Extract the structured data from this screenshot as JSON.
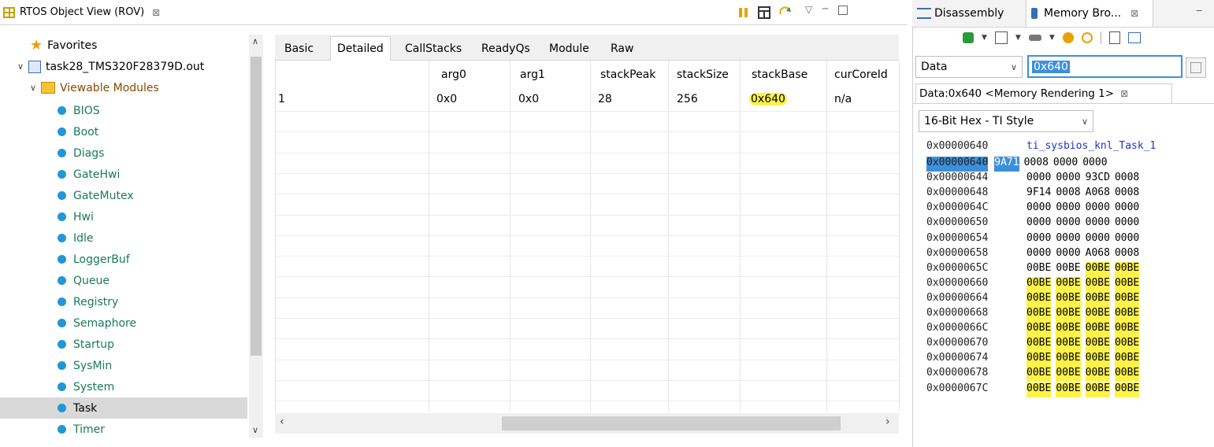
{
  "rov": {
    "title": "RTOS Object View (ROV)",
    "close_glyph": "⊠",
    "tree": {
      "favorites": "Favorites",
      "executable": "task28_TMS320F28379D.out",
      "viewable_modules": "Viewable Modules",
      "modules": [
        "BIOS",
        "Boot",
        "Diags",
        "GateHwi",
        "GateMutex",
        "Hwi",
        "Idle",
        "LoggerBuf",
        "Queue",
        "Registry",
        "Semaphore",
        "Startup",
        "SysMin",
        "System",
        "Task",
        "Timer"
      ],
      "selected": "Task"
    },
    "tabs": [
      "Basic",
      "Detailed",
      "CallStacks",
      "ReadyQs",
      "Module",
      "Raw"
    ],
    "active_tab": "Detailed",
    "table": {
      "columns": [
        "arg0",
        "arg1",
        "stackPeak",
        "stackSize",
        "stackBase",
        "curCoreId"
      ],
      "first_col_fragment": "1",
      "row": [
        "0x0",
        "0x0",
        "28",
        "256",
        "0x640",
        "n/a"
      ]
    }
  },
  "right": {
    "tabs": [
      "Disassembly",
      "Memory Bro..."
    ],
    "active_tab": "Memory Bro...",
    "close_glyph": "⊠",
    "page_select": "Data",
    "address_input": "0x640",
    "rendering_tab": "Data:0x640 <Memory Rendering 1>",
    "format_select": "16-Bit Hex - TI Style",
    "symbol_row": {
      "addr": "0x00000640",
      "symbol": "ti_sysbios_knl_Task_1"
    },
    "rows": [
      {
        "addr": "0x00000640",
        "vals": [
          "9A71",
          "0008",
          "0000",
          "0000"
        ]
      },
      {
        "addr": "0x00000644",
        "vals": [
          "0000",
          "0000",
          "93CD",
          "0008"
        ]
      },
      {
        "addr": "0x00000648",
        "vals": [
          "9F14",
          "0008",
          "A068",
          "0008"
        ]
      },
      {
        "addr": "0x0000064C",
        "vals": [
          "0000",
          "0000",
          "0000",
          "0000"
        ]
      },
      {
        "addr": "0x00000650",
        "vals": [
          "0000",
          "0000",
          "0000",
          "0000"
        ]
      },
      {
        "addr": "0x00000654",
        "vals": [
          "0000",
          "0000",
          "0000",
          "0000"
        ]
      },
      {
        "addr": "0x00000658",
        "vals": [
          "0000",
          "0000",
          "A068",
          "0008"
        ]
      },
      {
        "addr": "0x0000065C",
        "vals": [
          "00BE",
          "00BE",
          "00BE",
          "00BE"
        ]
      },
      {
        "addr": "0x00000660",
        "vals": [
          "00BE",
          "00BE",
          "00BE",
          "00BE"
        ]
      },
      {
        "addr": "0x00000664",
        "vals": [
          "00BE",
          "00BE",
          "00BE",
          "00BE"
        ]
      },
      {
        "addr": "0x00000668",
        "vals": [
          "00BE",
          "00BE",
          "00BE",
          "00BE"
        ]
      },
      {
        "addr": "0x0000066C",
        "vals": [
          "00BE",
          "00BE",
          "00BE",
          "00BE"
        ]
      },
      {
        "addr": "0x00000670",
        "vals": [
          "00BE",
          "00BE",
          "00BE",
          "00BE"
        ]
      },
      {
        "addr": "0x00000674",
        "vals": [
          "00BE",
          "00BE",
          "00BE",
          "00BE"
        ]
      },
      {
        "addr": "0x00000678",
        "vals": [
          "00BE",
          "00BE",
          "00BE",
          "00BE"
        ]
      },
      {
        "addr": "0x0000067C",
        "vals": [
          "00BE",
          "00BE",
          "00BE",
          "00BE"
        ]
      }
    ]
  },
  "colors": {
    "highlight": "#fdf24a",
    "selection": "#3c8fdc",
    "module_text": "#1a7a5a",
    "tree_dot": "#2196d9"
  }
}
